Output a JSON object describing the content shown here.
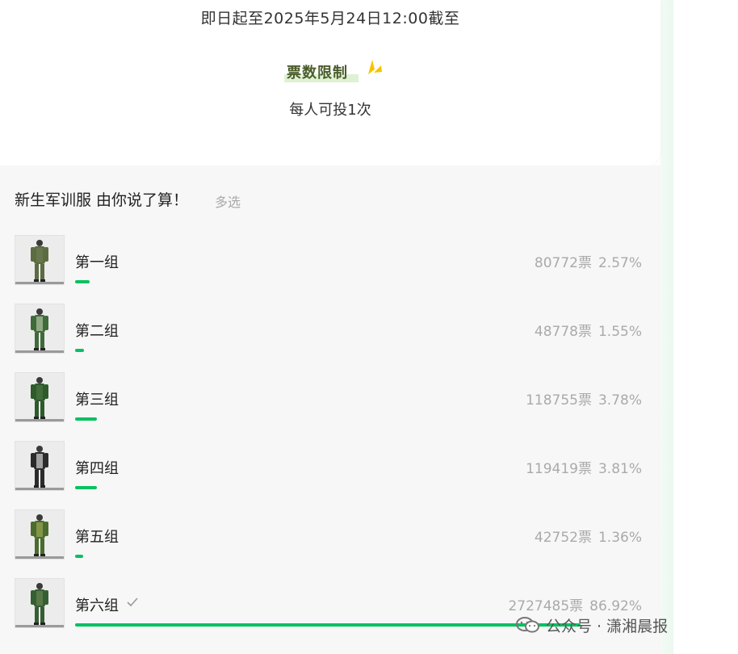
{
  "header": {
    "deadline": "即日起至2025年5月24日12:00截至",
    "limit_title": "票数限制",
    "limit_desc": "每人可投1次"
  },
  "poll": {
    "question": "新生军训服 由你说了算！",
    "mode": "多选",
    "accent_color": "#07c160",
    "options": [
      {
        "label": "第一组",
        "votes": "80772票",
        "percent": "2.57%",
        "share": 0.0257,
        "selected": false
      },
      {
        "label": "第二组",
        "votes": "48778票",
        "percent": "1.55%",
        "share": 0.0155,
        "selected": false
      },
      {
        "label": "第三组",
        "votes": "118755票",
        "percent": "3.78%",
        "share": 0.0378,
        "selected": false
      },
      {
        "label": "第四组",
        "votes": "119419票",
        "percent": "3.81%",
        "share": 0.0381,
        "selected": false
      },
      {
        "label": "第五组",
        "votes": "42752票",
        "percent": "1.36%",
        "share": 0.0136,
        "selected": false
      },
      {
        "label": "第六组",
        "votes": "2727485票",
        "percent": "86.92%",
        "share": 0.8692,
        "selected": true
      }
    ]
  },
  "watermark": {
    "text": "公众号 · 潇湘晨报",
    "icon": "wechat-icon"
  }
}
